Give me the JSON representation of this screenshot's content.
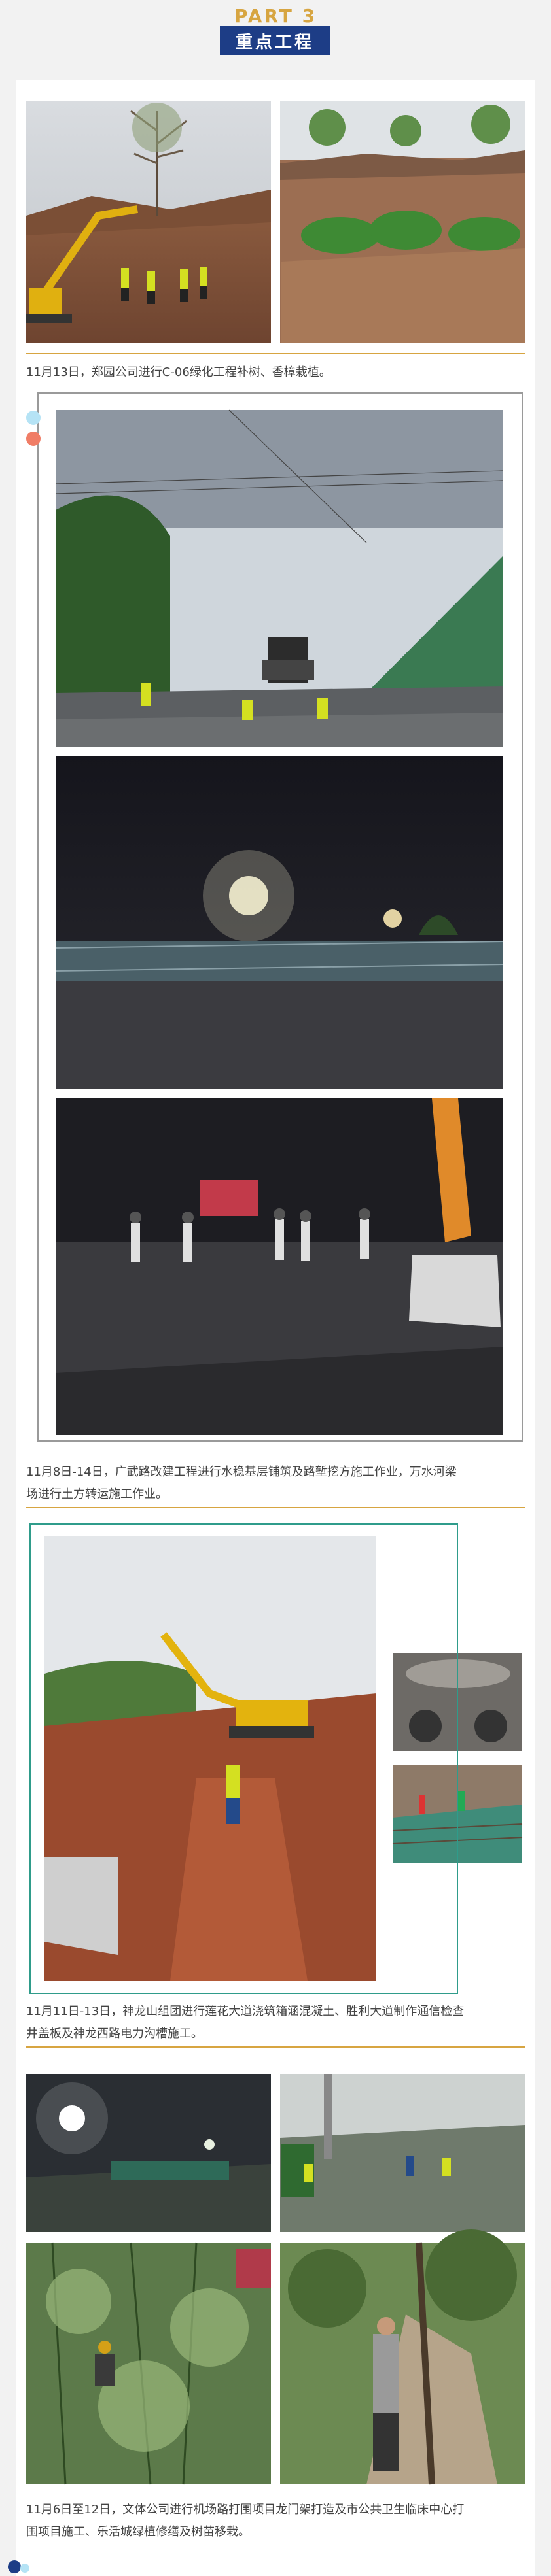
{
  "header": {
    "part_label": "PART 3",
    "section_title": "重点工程"
  },
  "colors": {
    "accent_gold": "#d7a541",
    "title_bar": "#1d3d86",
    "frame_gray": "#9a9a9a",
    "frame_teal": "#2f9c8b",
    "dot_blue": "#b5e3f5",
    "dot_orange": "#f07d66"
  },
  "captions": {
    "c1": "11月13日，郑园公司进行C-06绿化工程补树、香樟栽植。",
    "c2_line1": "11月8日-14日，广武路改建工程进行水稳基层铺筑及路堑挖方施工作业，万水河梁",
    "c2_line2": "场进行土方转运施工作业。",
    "c3_line1": "11月11日-13日，神龙山组团进行莲花大道浇筑箱涵混凝土、胜利大道制作通信检查",
    "c3_line2": "井盖板及神龙西路电力沟槽施工。",
    "c4_line1": "11月6日至12日，文体公司进行机场路打围项目龙门架打造及市公共卫生临床中心打",
    "c4_line2": "围项目施工、乐活城绿植修缮及树苗移栽。"
  }
}
